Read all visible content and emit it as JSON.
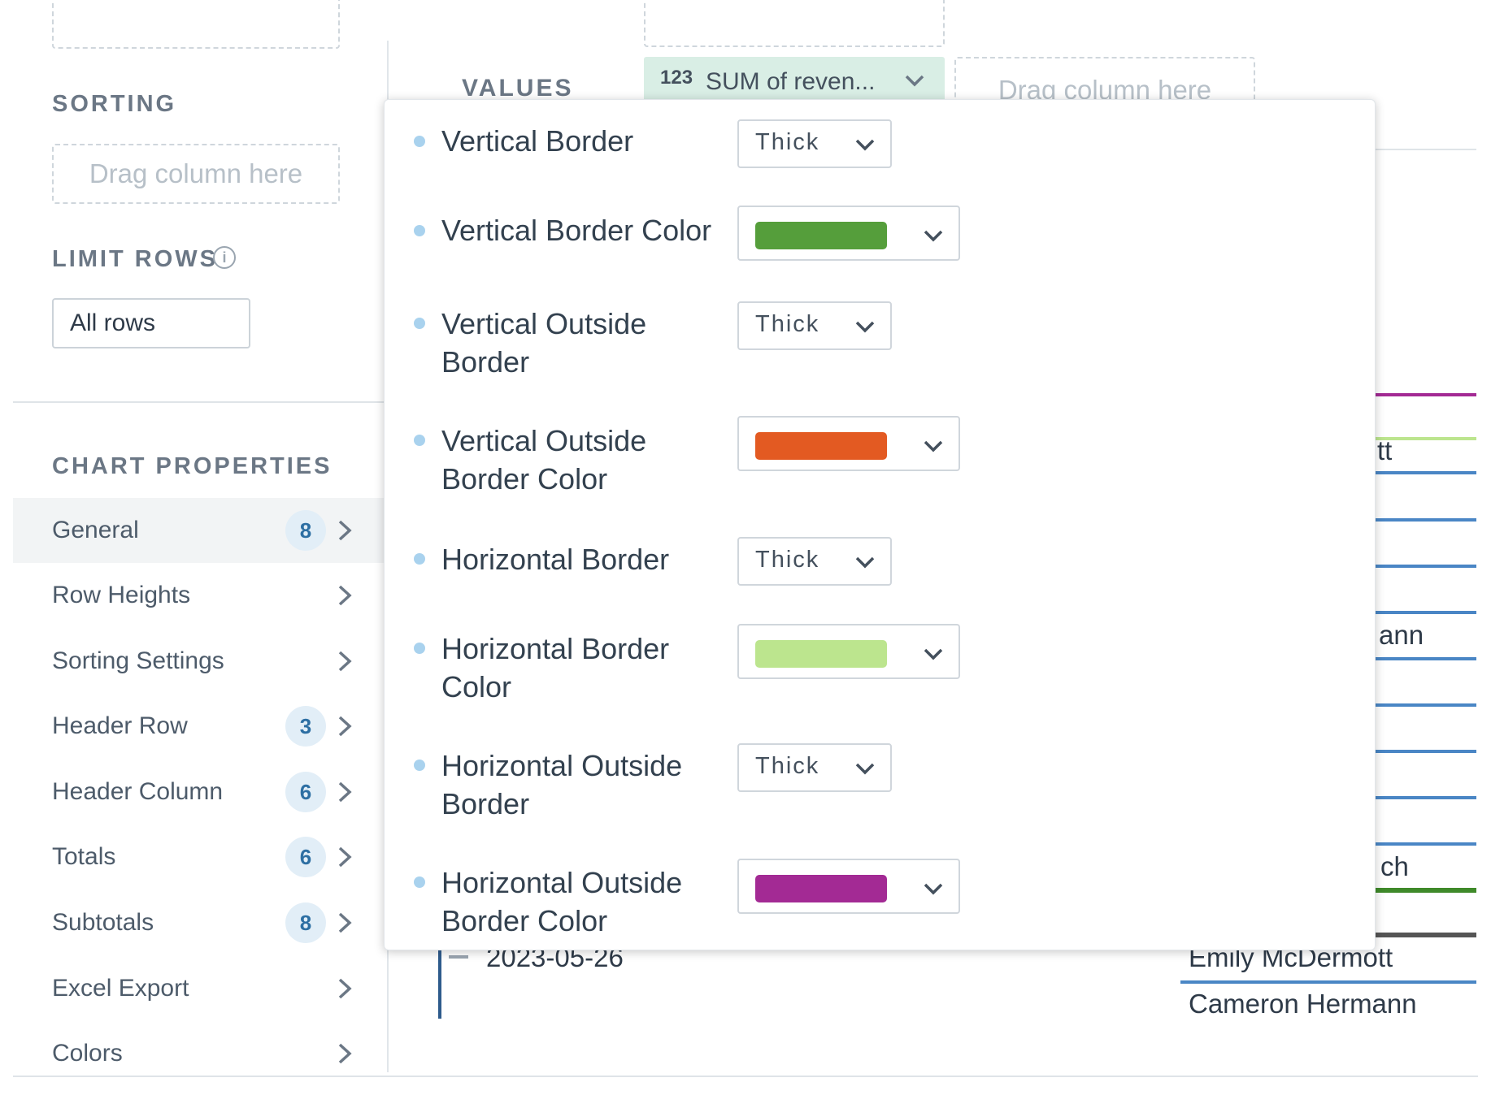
{
  "left_panel": {
    "sorting_title": "SORTING",
    "sorting_drop": "Drag column here",
    "limit_rows_title": "LIMIT ROWS",
    "info_icon": "i",
    "limit_rows_value": "All rows",
    "chart_properties_title": "CHART PROPERTIES",
    "nav": [
      {
        "label": "General",
        "badge": "8",
        "active": true
      },
      {
        "label": "Row Heights",
        "badge": ""
      },
      {
        "label": "Sorting Settings",
        "badge": ""
      },
      {
        "label": "Header Row",
        "badge": "3"
      },
      {
        "label": "Header Column",
        "badge": "6"
      },
      {
        "label": "Totals",
        "badge": "6"
      },
      {
        "label": "Subtotals",
        "badge": "8"
      },
      {
        "label": "Excel Export",
        "badge": ""
      },
      {
        "label": "Colors",
        "badge": ""
      }
    ]
  },
  "top_bar": {
    "values_label": "VALUES",
    "value_chip_icon": "123",
    "value_chip_label": "SUM of reven...",
    "drop_placeholder": "Drag column here"
  },
  "popup": {
    "rows": [
      {
        "label": "Vertical Border",
        "kind": "select",
        "value": "Thick"
      },
      {
        "label": "Vertical Border Color",
        "kind": "color",
        "color": "#559e3b"
      },
      {
        "label_lines": [
          "Vertical Outside",
          "Border"
        ],
        "kind": "select",
        "value": "Thick"
      },
      {
        "label_lines": [
          "Vertical Outside",
          "Border Color"
        ],
        "kind": "color",
        "color": "#e35a22"
      },
      {
        "label": "Horizontal Border",
        "kind": "select",
        "value": "Thick"
      },
      {
        "label_lines": [
          "Horizontal Border",
          "Color"
        ],
        "kind": "color",
        "color": "#bce58e"
      },
      {
        "label_lines": [
          "Horizontal Outside",
          "Border"
        ],
        "kind": "select",
        "value": "Thick"
      },
      {
        "label_lines": [
          "Horizontal Outside",
          "Border Color"
        ],
        "kind": "color",
        "color": "#a32a94"
      }
    ]
  },
  "background_table": {
    "date_row": "2023-05-26",
    "fragments": [
      "tt",
      "ann",
      "ch"
    ],
    "names": [
      "Emily McDermott",
      "Cameron Hermann"
    ]
  },
  "colors": {
    "badge_bg": "#e2eef7",
    "badge_text": "#2d6fa3",
    "chip_bg": "#d9eee5",
    "line_blue": "#4a86c5",
    "line_purple": "#a32a94",
    "line_lightgreen": "#bce58e",
    "line_darkgreen": "#3f8a2a",
    "line_gray": "#555555"
  }
}
